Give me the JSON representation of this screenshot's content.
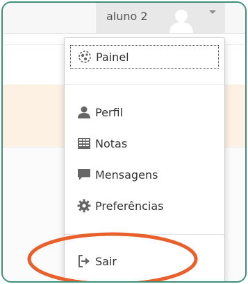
{
  "user": {
    "name": "aluno 2"
  },
  "menu": {
    "items": [
      {
        "label": "Painel",
        "icon": "dashboard-icon"
      },
      {
        "label": "Perfil",
        "icon": "user-icon"
      },
      {
        "label": "Notas",
        "icon": "grades-icon"
      },
      {
        "label": "Mensagens",
        "icon": "message-icon"
      },
      {
        "label": "Preferências",
        "icon": "gear-icon"
      },
      {
        "label": "Sair",
        "icon": "logout-icon"
      }
    ]
  },
  "colors": {
    "frame": "#3d8f78",
    "highlight": "#e8602c",
    "icon": "#666666"
  }
}
